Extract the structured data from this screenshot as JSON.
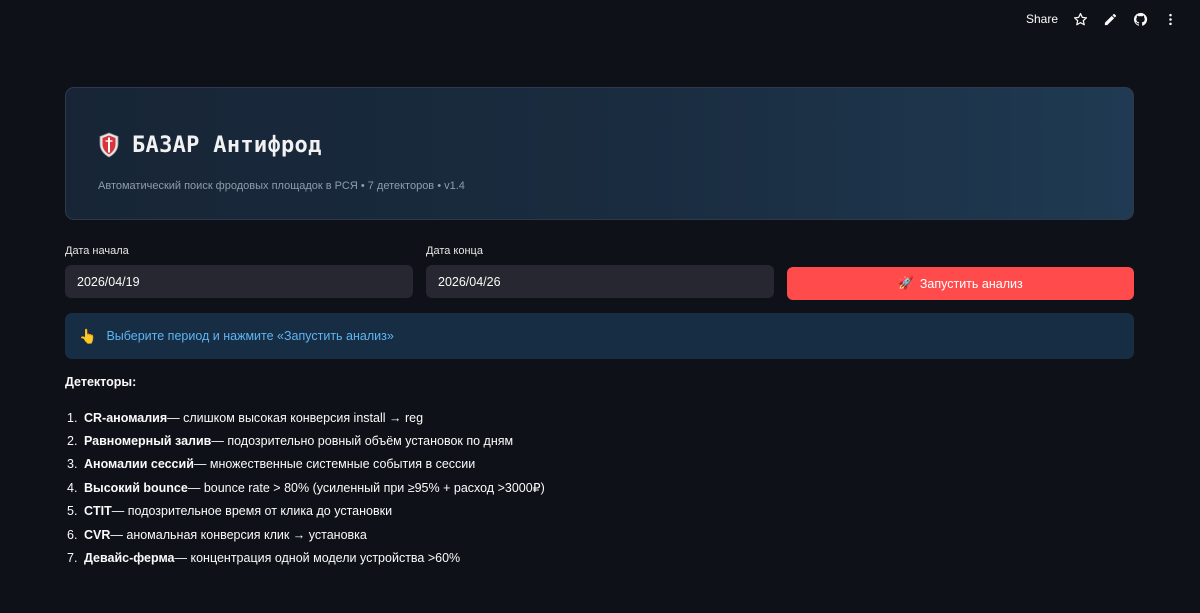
{
  "toolbar": {
    "share_label": "Share",
    "icons": [
      "star-icon",
      "edit-icon",
      "github-icon",
      "more-vertical-icon"
    ]
  },
  "header": {
    "icon": "shield-icon",
    "title": "БАЗАР Антифрод",
    "subtitle": "Автоматический поиск фродовых площадок в РСЯ • 7 детекторов • v1.4"
  },
  "form": {
    "start_label": "Дата начала",
    "start_value": "2026/04/19",
    "end_label": "Дата конца",
    "end_value": "2026/04/26",
    "run_icon": "🚀",
    "run_label": "Запустить анализ"
  },
  "info": {
    "icon": "👆",
    "message": "Выберите период и нажмите «Запустить анализ»"
  },
  "detectors": {
    "title": "Детекторы:",
    "items": [
      {
        "num": "1.",
        "name": "CR-аномалия",
        "desc": " — слишком высокая конверсия install → reg"
      },
      {
        "num": "2.",
        "name": "Равномерный залив",
        "desc": " — подозрительно ровный объём установок по дням"
      },
      {
        "num": "3.",
        "name": "Аномалии сессий",
        "desc": " — множественные системные события в сессии"
      },
      {
        "num": "4.",
        "name": "Высокий bounce",
        "desc": " — bounce rate > 80% (усиленный при ≥95% + расход >3000₽)"
      },
      {
        "num": "5.",
        "name": "CTIT",
        "desc": " — подозрительное время от клика до установки"
      },
      {
        "num": "6.",
        "name": "CVR",
        "desc": " — аномальная конверсия клик → установка"
      },
      {
        "num": "7.",
        "name": "Девайс-ферма",
        "desc": " — концентрация одной модели устройства >60%"
      }
    ]
  },
  "colors": {
    "background": "#0e1117",
    "primary_button": "#ff4b4b",
    "info_background": "#172d43",
    "info_text": "#5eb4f2"
  }
}
